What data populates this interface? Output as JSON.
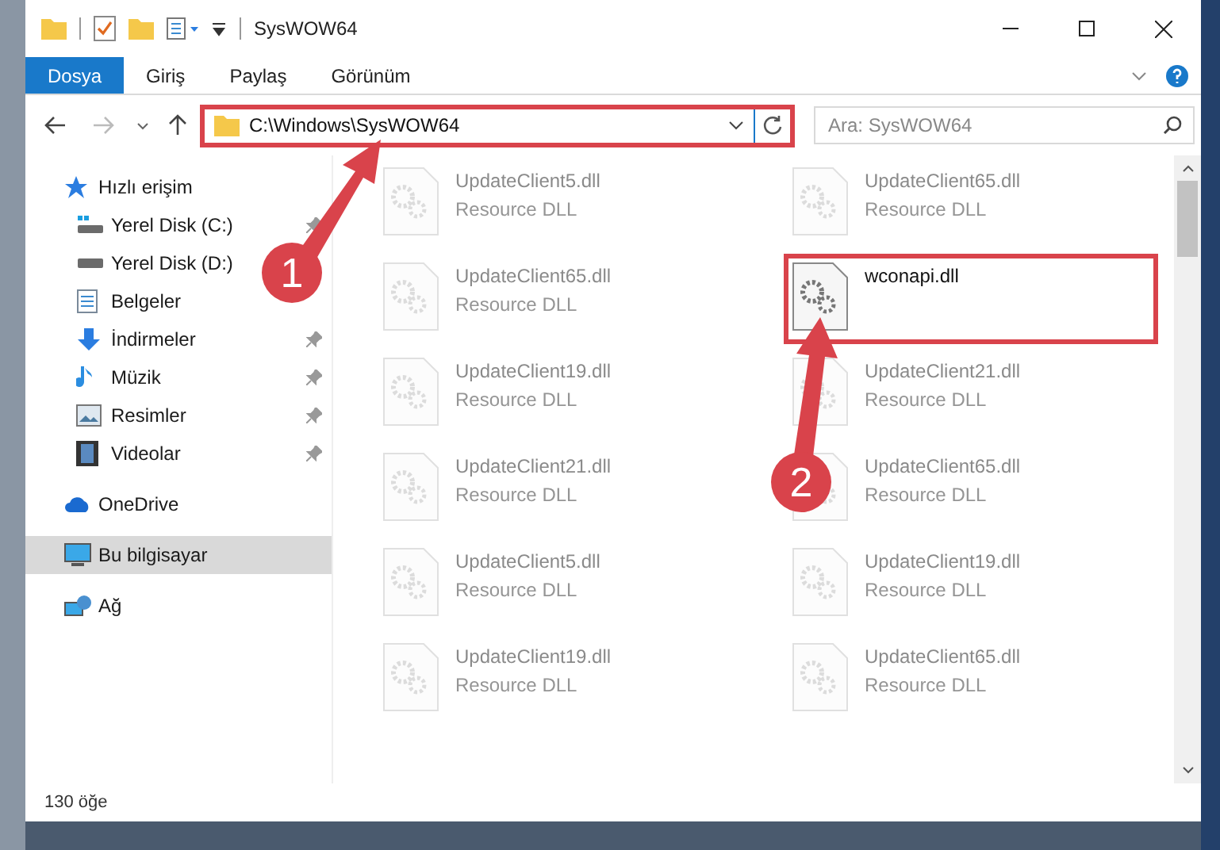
{
  "window": {
    "title": "SysWOW64"
  },
  "ribbon_tabs": [
    {
      "label": "Dosya",
      "selected": true
    },
    {
      "label": "Giriş",
      "selected": false
    },
    {
      "label": "Paylaş",
      "selected": false
    },
    {
      "label": "Görünüm",
      "selected": false
    }
  ],
  "address_bar": {
    "path": "C:\\Windows\\SysWOW64",
    "highlighted": true
  },
  "search": {
    "placeholder": "Ara: SysWOW64"
  },
  "sidebar": {
    "items": [
      {
        "label": "Hızlı erişim",
        "kind": "star",
        "selected": false,
        "children": [
          {
            "label": "Yerel Disk (C:)",
            "kind": "drive-win",
            "selected": false,
            "pinned": true
          },
          {
            "label": "Yerel Disk (D:)",
            "kind": "drive",
            "selected": false
          },
          {
            "label": "Belgeler",
            "kind": "document",
            "selected": false
          },
          {
            "label": "İndirmeler",
            "kind": "download",
            "selected": false,
            "pinned": true
          },
          {
            "label": "Müzik",
            "kind": "music",
            "selected": false,
            "pinned": true
          },
          {
            "label": "Resimler",
            "kind": "picture",
            "selected": false,
            "pinned": true
          },
          {
            "label": "Videolar",
            "kind": "video",
            "selected": false,
            "pinned": true
          }
        ]
      },
      {
        "label": "OneDrive",
        "kind": "cloud",
        "selected": false
      },
      {
        "label": "Bu bilgisayar",
        "kind": "computer",
        "selected": true
      },
      {
        "label": "Ağ",
        "kind": "network",
        "selected": false
      }
    ]
  },
  "files": [
    {
      "name": "UpdateClient5.dll",
      "type": "Resource DLL",
      "faded": true,
      "highlighted": false
    },
    {
      "name": "UpdateClient65.dll",
      "type": "Resource DLL",
      "faded": true,
      "highlighted": false
    },
    {
      "name": "UpdateClient65.dll",
      "type": "Resource DLL",
      "faded": true,
      "highlighted": false
    },
    {
      "name": "wconapi.dll",
      "faded": false,
      "highlighted": true
    },
    {
      "name": "UpdateClient19.dll",
      "type": "Resource DLL",
      "faded": true,
      "highlighted": false
    },
    {
      "name": "UpdateClient21.dll",
      "type": "Resource DLL",
      "faded": true,
      "highlighted": false
    },
    {
      "name": "UpdateClient21.dll",
      "type": "Resource DLL",
      "faded": true,
      "highlighted": false
    },
    {
      "name": "UpdateClient65.dll",
      "type": "Resource DLL",
      "faded": true,
      "highlighted": false
    },
    {
      "name": "UpdateClient5.dll",
      "type": "Resource DLL",
      "faded": true,
      "highlighted": false
    },
    {
      "name": "UpdateClient19.dll",
      "type": "Resource DLL",
      "faded": true,
      "highlighted": false
    },
    {
      "name": "UpdateClient19.dll",
      "type": "Resource DLL",
      "faded": true,
      "highlighted": false
    },
    {
      "name": "UpdateClient65.dll",
      "type": "Resource DLL",
      "faded": true,
      "highlighted": false
    }
  ],
  "status_bar": {
    "count": "130 öğe"
  },
  "annotations": [
    {
      "label": "1"
    },
    {
      "label": "2"
    }
  ]
}
